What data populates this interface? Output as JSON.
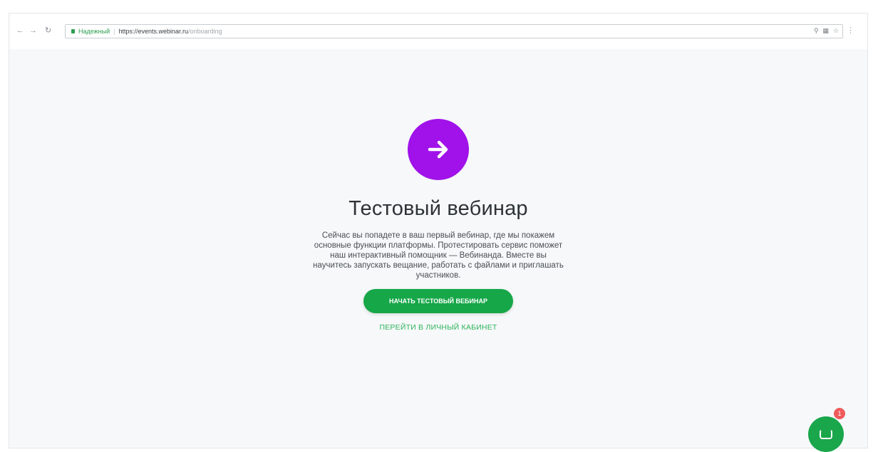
{
  "browser": {
    "back_icon": "arrow-left-icon",
    "forward_icon": "arrow-right-icon",
    "reload_icon": "reload-icon",
    "secure_label": "Надежный",
    "url_main": "https://events.webinar.ru",
    "url_path": "/onboarding",
    "zoom_icon": "zoom-icon",
    "extension_icon": "extension-icon",
    "star_icon": "star-icon",
    "menu_icon": "menu-dots-icon"
  },
  "onboarding": {
    "icon": "arrow-right-icon",
    "icon_color": "#a012e9",
    "title": "Тестовый вебинар",
    "description": "Сейчас вы попадете в ваш первый вебинар, где мы покажем основные функции платформы. Протестировать сервис поможет наш интерактивный помощник — Вебинанда. Вместе вы научитесь запускать вещание, работать с файлами и приглашать участников.",
    "primary_button": "НАЧАТЬ ТЕСТОВЫЙ ВЕБИНАР",
    "primary_color": "#16a748",
    "secondary_link": "ПЕРЕЙТИ В ЛИЧНЫЙ КАБИНЕТ"
  },
  "chat": {
    "icon": "chat-icon",
    "badge_count": "1"
  }
}
